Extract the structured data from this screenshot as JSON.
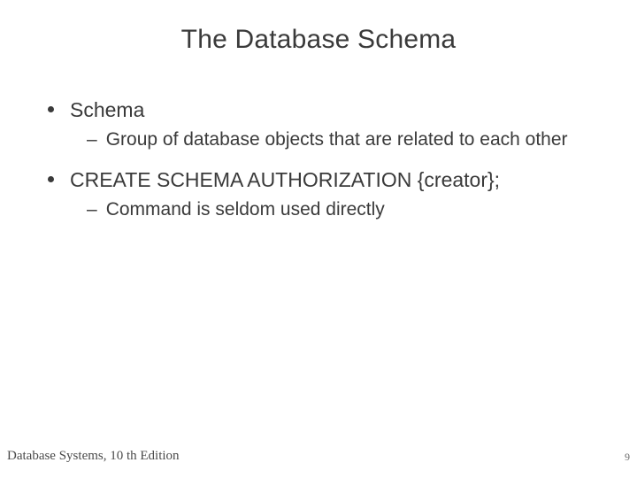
{
  "title": "The Database Schema",
  "bullets": {
    "b1": {
      "text": "Schema",
      "sub": "Group of database objects that are related to each other"
    },
    "b2": {
      "text": "CREATE SCHEMA AUTHORIZATION {creator};",
      "sub": "Command is seldom used directly"
    }
  },
  "dash": "–",
  "footer": {
    "left": "Database Systems, 10 th Edition",
    "page": "9"
  }
}
